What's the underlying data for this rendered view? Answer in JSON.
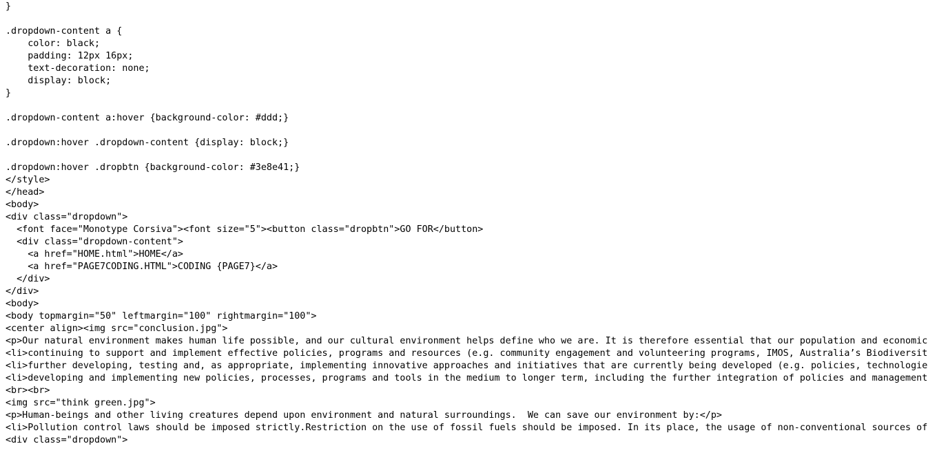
{
  "editor": {
    "lines": [
      "}",
      "",
      ".dropdown-content a {",
      "    color: black;",
      "    padding: 12px 16px;",
      "    text-decoration: none;",
      "    display: block;",
      "}",
      "",
      ".dropdown-content a:hover {background-color: #ddd;}",
      "",
      ".dropdown:hover .dropdown-content {display: block;}",
      "",
      ".dropdown:hover .dropbtn {background-color: #3e8e41;}",
      "</style>",
      "</head>",
      "<body>",
      "<div class=\"dropdown\">",
      "  <font face=\"Monotype Corsiva\"><font size=\"5\"><button class=\"dropbtn\">GO FOR</button>",
      "  <div class=\"dropdown-content\">",
      "    <a href=\"HOME.html\">HOME</a>",
      "    <a href=\"PAGE7CODING.HTML\">CODING {PAGE7}</a>",
      "  </div>",
      "</div>",
      "<body>",
      "<body topmargin=\"50\" leftmargin=\"100\" rightmargin=\"100\">",
      "<center align><img src=\"conclusion.jpg\">",
      "<p>Our natural environment makes human life possible, and our cultural environment helps define who we are. It is therefore essential that our population and economic",
      "<li>continuing to support and implement effective policies, programs and resources (e.g. community engagement and volunteering programs, IMOS, Australia’s Biodiversity",
      "<li>further developing, testing and, as appropriate, implementing innovative approaches and initiatives that are currently being developed (e.g. policies, technologies",
      "<li>developing and implementing new policies, processes, programs and tools in the medium to longer term, including the further integration of policies and management",
      "<br><br>",
      "<img src=\"think green.jpg\">",
      "<p>Human-beings and other living creatures depend upon environment and natural surroundings.  We can save our environment by:</p>",
      "<li>Pollution control laws should be imposed strictly.Restriction on the use of fossil fuels should be imposed. In its place, the usage of non-conventional sources of",
      "<div class=\"dropdown\">"
    ]
  }
}
